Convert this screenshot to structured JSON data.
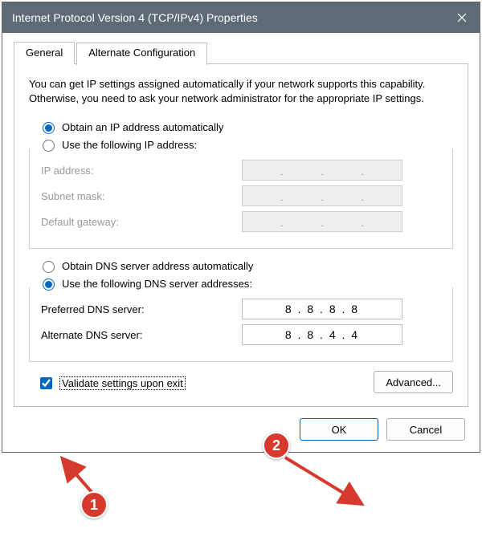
{
  "window": {
    "title": "Internet Protocol Version 4 (TCP/IPv4) Properties"
  },
  "tabs": {
    "general": "General",
    "alternate": "Alternate Configuration"
  },
  "description": "You can get IP settings assigned automatically if your network supports this capability. Otherwise, you need to ask your network administrator for the appropriate IP settings.",
  "ip": {
    "auto_label": "Obtain an IP address automatically",
    "manual_label": "Use the following IP address:",
    "ip_label": "IP address:",
    "subnet_label": "Subnet mask:",
    "gateway_label": "Default gateway:",
    "ip_value": "",
    "subnet_value": "",
    "gateway_value": ""
  },
  "dns": {
    "auto_label": "Obtain DNS server address automatically",
    "manual_label": "Use the following DNS server addresses:",
    "preferred_label": "Preferred DNS server:",
    "alternate_label": "Alternate DNS server:",
    "preferred_value": "8 . 8 . 8 . 8",
    "alternate_value": "8 . 8 . 4 . 4"
  },
  "validate_label": "Validate settings upon exit",
  "advanced_label": "Advanced...",
  "ok_label": "OK",
  "cancel_label": "Cancel",
  "annotations": {
    "badge1": "1",
    "badge2": "2"
  }
}
